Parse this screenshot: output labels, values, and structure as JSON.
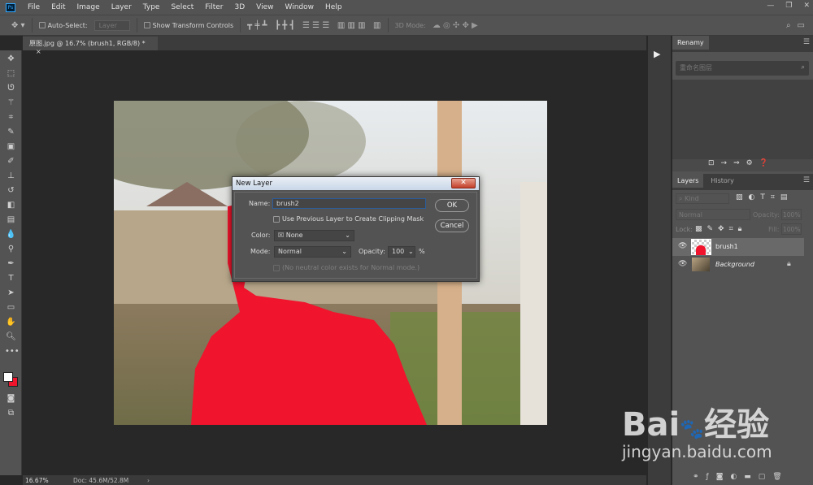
{
  "menubar": {
    "logo": "Ps",
    "items": [
      "File",
      "Edit",
      "Image",
      "Layer",
      "Type",
      "Select",
      "Filter",
      "3D",
      "View",
      "Window",
      "Help"
    ],
    "window_controls": [
      "—",
      "❐",
      "✕"
    ]
  },
  "options": {
    "auto_select_label": "Auto-Select:",
    "auto_select_value": "Layer",
    "show_transform_label": "Show Transform Controls",
    "mode_3d_label": "3D Mode:"
  },
  "document_tab": {
    "title": "原图.jpg @ 16.7% (brush1, RGB/8) *",
    "close": "×"
  },
  "status": {
    "zoom": "16.67%",
    "doc": "Doc: 45.6M/52.8M",
    "arrow": "›"
  },
  "renamy": {
    "tab": "Renamy",
    "search_placeholder": "重命名图层"
  },
  "layers_panel": {
    "tabs": [
      "Layers",
      "History"
    ],
    "kind": "Kind",
    "blend": "Normal",
    "opacity_label": "Opacity:",
    "opacity": "100%",
    "lock_label": "Lock:",
    "fill_label": "Fill:",
    "fill": "100%",
    "layers": [
      {
        "name": "brush1",
        "selected": true
      },
      {
        "name": "Background",
        "locked": true
      }
    ]
  },
  "dialog": {
    "title": "New Layer",
    "name_label": "Name:",
    "name_value": "brush2",
    "clip_label": "Use Previous Layer to Create Clipping Mask",
    "color_label": "Color:",
    "color_value": "None",
    "mode_label": "Mode:",
    "mode_value": "Normal",
    "opacity_label": "Opacity:",
    "opacity_value": "100",
    "percent": "%",
    "neutral_label": "(No neutral color exists for Normal mode.)",
    "ok": "OK",
    "cancel": "Cancel"
  },
  "watermark": {
    "brand": "Bai du 经验",
    "url": "jingyan.baidu.com"
  },
  "colors": {
    "mask_red": "#f0142d",
    "panel": "#535353",
    "canvas_bg": "#282828"
  }
}
